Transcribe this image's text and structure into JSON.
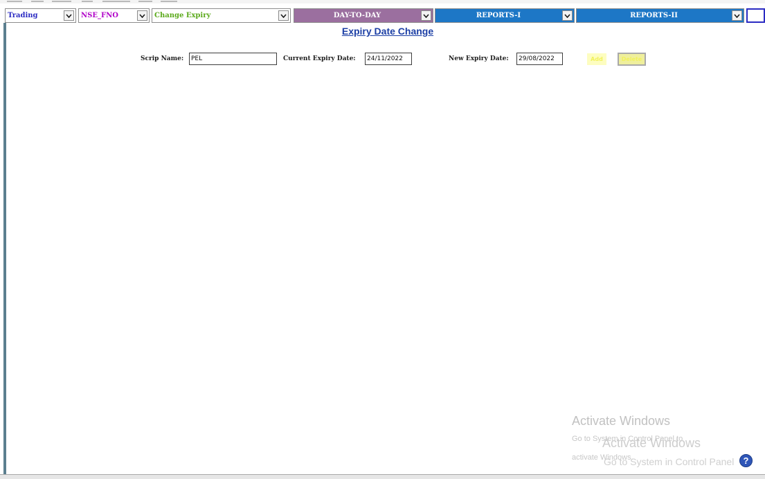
{
  "nav": {
    "items": [
      {
        "label": "Trading",
        "color": "#2a2ac2",
        "bg": "#ffffff"
      },
      {
        "label": "NSE_FNO",
        "color": "#b000c8",
        "bg": "#ffffff"
      },
      {
        "label": "Change Expiry",
        "color": "#5aa91a",
        "bg": "#ffffff"
      },
      {
        "label": "DAY-TO-DAY",
        "color": "#ffffff",
        "bg": "#9b6f9f"
      },
      {
        "label": "REPORTS-I",
        "color": "#ffffff",
        "bg": "#1d77c6"
      },
      {
        "label": "REPORTS-II",
        "color": "#ffffff",
        "bg": "#1d77c6"
      }
    ]
  },
  "page": {
    "title": "Expiry Date Change"
  },
  "form": {
    "scrip_label": "Scrip Name:",
    "scrip_value": "PEL",
    "current_label": "Current Expiry Date:",
    "current_value": "24/11/2022",
    "new_label": "New Expiry Date:",
    "new_value": "29/08/2022",
    "add_label": "Add",
    "delete_label": "Delete"
  },
  "watermark": {
    "title": "Activate Windows",
    "subtitle": "Go to System in Control Panel to",
    "subtitle2": "activate Windows.",
    "title_ghost": "Activate Windows",
    "subtitle_ghost": "Go to System in Control Panel"
  },
  "icons": {
    "help": "help-icon",
    "dropdown": "chevron-down-icon"
  }
}
